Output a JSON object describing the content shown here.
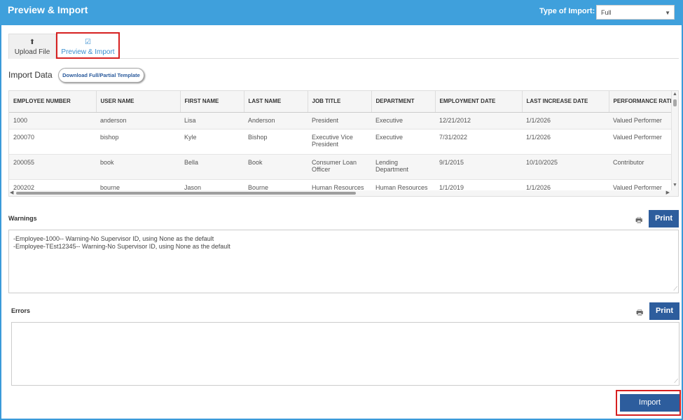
{
  "header": {
    "title": "Preview & Import",
    "type_label": "Type of Import:",
    "type_value": "Full"
  },
  "tabs": [
    {
      "label": "Upload File",
      "icon": "upload-icon"
    },
    {
      "label": "Preview & Import",
      "icon": "checkbox-icon",
      "active": true
    }
  ],
  "import_data": {
    "title": "Import Data",
    "template_button": "Download Full/Partial Template"
  },
  "grid": {
    "columns": [
      "EMPLOYEE NUMBER",
      "USER NAME",
      "FIRST NAME",
      "LAST NAME",
      "JOB TITLE",
      "DEPARTMENT",
      "EMPLOYMENT DATE",
      "LAST INCREASE DATE",
      "PERFORMANCE RATII"
    ],
    "rows": [
      [
        "1000",
        "anderson",
        "Lisa",
        "Anderson",
        "President",
        "Executive",
        "12/21/2012",
        "1/1/2026",
        "Valued Performer"
      ],
      [
        "200070",
        "bishop",
        "Kyle",
        "Bishop",
        "Executive Vice President",
        "Executive",
        "7/31/2022",
        "1/1/2026",
        "Valued Performer"
      ],
      [
        "200055",
        "book",
        "Bella",
        "Book",
        "Consumer Loan Officer",
        "Lending Department",
        "9/1/2015",
        "10/10/2025",
        "Contributor"
      ],
      [
        "200202",
        "bourne",
        "Jason",
        "Bourne",
        "Human Resources",
        "Human Resources",
        "1/1/2019",
        "1/1/2026",
        "Valued Performer"
      ]
    ]
  },
  "warnings": {
    "label": "Warnings",
    "print_label": "Print",
    "lines": [
      "-Employee-1000-- Warning-No Supervisor ID, using None as the default",
      "-Employee-TEst12345-- Warning-No Supervisor ID, using None as the default"
    ]
  },
  "errors": {
    "label": "Errors",
    "print_label": "Print"
  },
  "import_button": "Import",
  "colors": {
    "header": "#3fa0dc",
    "button": "#2d5d9d",
    "highlight": "#d62020"
  }
}
